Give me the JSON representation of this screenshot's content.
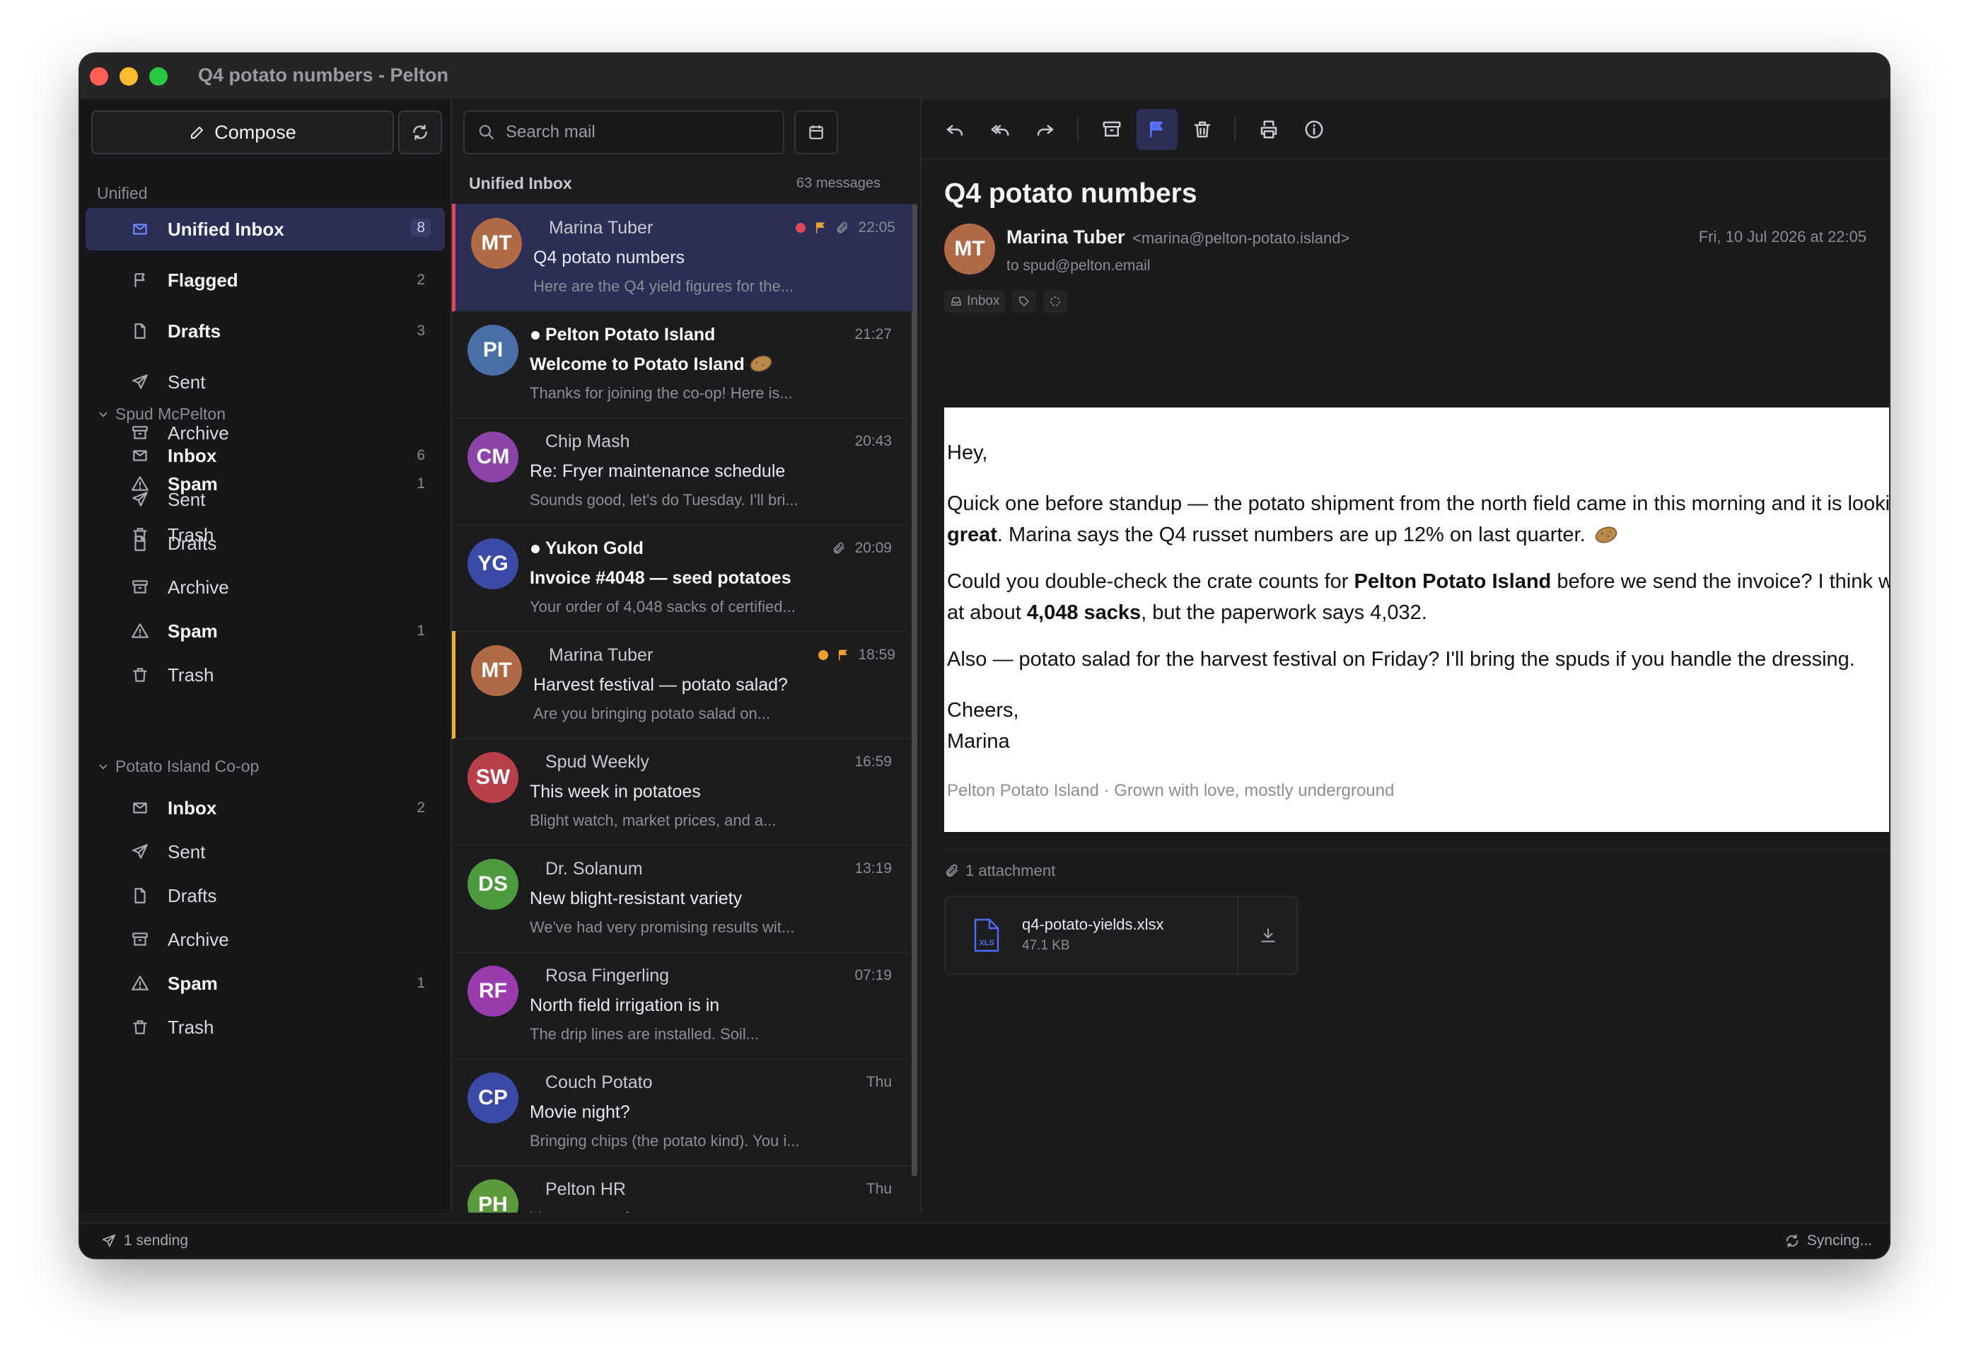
{
  "window": {
    "title": "Q4 potato numbers - Pelton"
  },
  "sidebar": {
    "compose_label": "Compose",
    "unified_label": "Unified",
    "unified_items": [
      {
        "label": "Unified Inbox",
        "count": "8",
        "icon": "inbox-icon"
      },
      {
        "label": "Flagged",
        "count": "2",
        "icon": "flag-icon"
      },
      {
        "label": "Drafts",
        "count": "3",
        "icon": "file-icon"
      },
      {
        "label": "Sent",
        "count": "",
        "icon": "send-icon"
      },
      {
        "label": "Archive",
        "count": "",
        "icon": "archive-icon"
      },
      {
        "label": "Spam",
        "count": "1",
        "icon": "warning-icon"
      },
      {
        "label": "Trash",
        "count": "",
        "icon": "trash-icon"
      }
    ],
    "accounts": [
      {
        "name": "Spud McPelton",
        "items": [
          {
            "label": "Inbox",
            "count": "6"
          },
          {
            "label": "Sent",
            "count": ""
          },
          {
            "label": "Drafts",
            "count": ""
          },
          {
            "label": "Archive",
            "count": ""
          },
          {
            "label": "Spam",
            "count": "1"
          },
          {
            "label": "Trash",
            "count": ""
          }
        ]
      },
      {
        "name": "Potato Island Co-op",
        "items": [
          {
            "label": "Inbox",
            "count": "2"
          },
          {
            "label": "Sent",
            "count": ""
          },
          {
            "label": "Drafts",
            "count": ""
          },
          {
            "label": "Archive",
            "count": ""
          },
          {
            "label": "Spam",
            "count": "1"
          },
          {
            "label": "Trash",
            "count": ""
          }
        ]
      }
    ]
  },
  "list": {
    "search_placeholder": "Search mail",
    "title": "Unified Inbox",
    "count_text": "63 messages",
    "messages": [
      {
        "initials": "MT",
        "color": "#b06a47",
        "from": "Marina Tuber",
        "time": "22:05",
        "subject": "Q4 potato numbers",
        "preview": "Here are the Q4 yield figures for the...",
        "selected": true,
        "unread": false,
        "flag": true,
        "attachment": true,
        "dot": "#e2475a"
      },
      {
        "initials": "PI",
        "color": "#4a6fa8",
        "from": "Pelton Potato Island",
        "time": "21:27",
        "subject": "Welcome to Potato Island",
        "preview": "Thanks for joining the co-op! Here is...",
        "unread": true,
        "potato": true
      },
      {
        "initials": "CM",
        "color": "#8b44a8",
        "from": "Chip Mash",
        "time": "20:43",
        "subject": "Re: Fryer maintenance schedule",
        "preview": "Sounds good, let's do Tuesday. I'll bri..."
      },
      {
        "initials": "YG",
        "color": "#3b4aa6",
        "from": "Yukon Gold",
        "time": "20:09",
        "subject": "Invoice #4048 — seed potatoes",
        "preview": "Your order of 4,048 sacks of certified...",
        "unread": true,
        "attachment": true
      },
      {
        "initials": "MT",
        "color": "#b06a47",
        "from": "Marina Tuber",
        "time": "18:59",
        "subject": "Harvest festival — potato salad?",
        "preview": "Are you bringing potato salad on...",
        "flagged_row": true,
        "flag": true,
        "dot": "#f0a030"
      },
      {
        "initials": "SW",
        "color": "#b8404a",
        "from": "Spud Weekly",
        "time": "16:59",
        "subject": "This week in potatoes",
        "preview": "Blight watch, market prices, and a..."
      },
      {
        "initials": "DS",
        "color": "#4e9a3e",
        "from": "Dr. Solanum",
        "time": "13:19",
        "subject": "New blight-resistant variety",
        "preview": "We've had very promising results wit..."
      },
      {
        "initials": "RF",
        "color": "#9a3cae",
        "from": "Rosa Fingerling",
        "time": "07:19",
        "subject": "North field irrigation is in",
        "preview": "The drip lines are installed. Soil..."
      },
      {
        "initials": "CP",
        "color": "#3b4aa6",
        "from": "Couch Potato",
        "time": "Thu",
        "subject": "Movie night?",
        "preview": "Bringing chips (the potato kind). You i..."
      },
      {
        "initials": "PH",
        "color": "#5a9a3a",
        "from": "Pelton HR",
        "time": "Thu",
        "subject": "Your potato-leave request",
        "preview": ""
      }
    ]
  },
  "reader": {
    "subject": "Q4 potato numbers",
    "initials": "MT",
    "sender_name": "Marina Tuber",
    "sender_email": "<marina@pelton-potato.island>",
    "to": "to spud@pelton.email",
    "date": "Fri, 10 Jul 2026 at 22:05",
    "tag": "Inbox",
    "body": {
      "greeting": "Hey,",
      "p1_a": "Quick one before standup — the potato shipment from the north field came in this morning and it is looking",
      "p1_b": "great",
      "p1_c": ". Marina says the Q4 russet numbers are up 12% on last quarter.",
      "p2_a": "Could you double-check the crate counts for",
      "p2_b": "Pelton Potato Island",
      "p2_c": "before we send the invoice? I think we are at about",
      "p2_d": "4,048 sacks",
      "p2_e": ", but the paperwork says 4,032.",
      "p3": "Also — potato salad for the harvest festival on Friday? I'll bring the spuds if you handle the dressing.",
      "closing": "Cheers,",
      "signoff": "Marina",
      "signature": "Pelton Potato Island · Grown with love, mostly underground"
    },
    "attachments_label": "1 attachment",
    "attachment": {
      "name": "q4-potato-yields.xlsx",
      "size": "47.1 KB",
      "type": "XLS"
    }
  },
  "status": {
    "left": "1 sending",
    "right": "Syncing..."
  }
}
